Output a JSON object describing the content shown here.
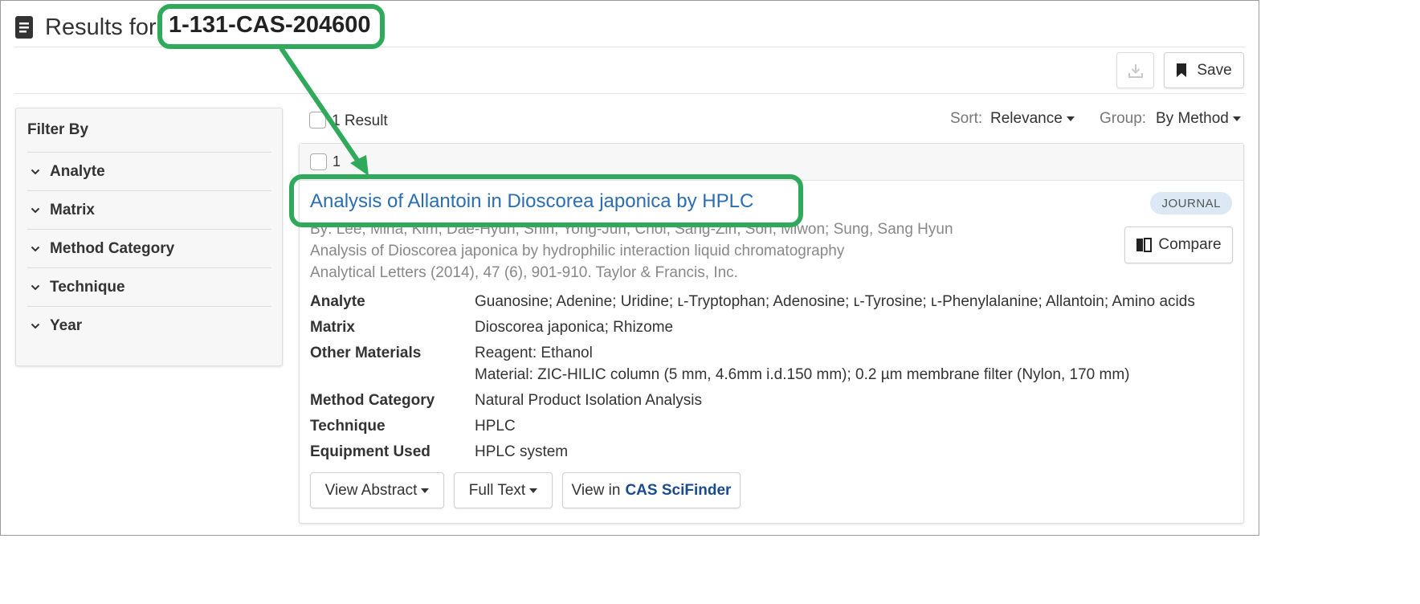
{
  "header": {
    "title_prefix": "Results for",
    "query": "1-131-CAS-204600"
  },
  "toolbar": {
    "download_icon": "download-icon",
    "save_label": "Save",
    "save_icon": "bookmark-icon"
  },
  "filter": {
    "title": "Filter By",
    "items": [
      {
        "label": "Analyte"
      },
      {
        "label": "Matrix"
      },
      {
        "label": "Method Category"
      },
      {
        "label": "Technique"
      },
      {
        "label": "Year"
      }
    ]
  },
  "results_bar": {
    "count": "1 Result",
    "sort_label": "Sort:",
    "sort_value": "Relevance",
    "group_label": "Group:",
    "group_value": "By Method"
  },
  "result": {
    "index": "1",
    "title": "Analysis of Allantoin in Dioscorea japonica by HPLC",
    "badge": "JOURNAL",
    "compare_label": "Compare",
    "authors": "By: Lee, Mina; Kim, Dae-Hyun; Shin, Yong-Jun; Choi, Sang-Zin; Son, Miwon; Sung, Sang Hyun",
    "subtitle": "Analysis of Dioscorea japonica by hydrophilic interaction liquid chromatography",
    "citation": "Analytical Letters (2014), 47 (6), 901-910. Taylor & Francis, Inc.",
    "fields": [
      {
        "label": "Analyte",
        "value": "Guanosine; Adenine; Uridine; ʟ-Tryptophan; Adenosine; ʟ-Tyrosine; ʟ-Phenylalanine; Allantoin; Amino acids"
      },
      {
        "label": "Matrix",
        "value": "Dioscorea japonica; Rhizome"
      },
      {
        "label": "Other Materials",
        "value": "Reagent: Ethanol",
        "value2": "Material: ZIC-HILIC column (5 mm, 4.6mm i.d.150 mm); 0.2 µm membrane filter (Nylon, 170 mm)"
      },
      {
        "label": "Method Category",
        "value": "Natural Product Isolation Analysis"
      },
      {
        "label": "Technique",
        "value": "HPLC"
      },
      {
        "label": "Equipment Used",
        "value": "HPLC system"
      }
    ],
    "buttons": {
      "view_abstract": "View Abstract",
      "full_text": "Full Text",
      "view_in": "View in",
      "scifinder": "CAS SciFinder"
    }
  },
  "colors": {
    "link": "#2a6db3",
    "callout": "#2faa5a",
    "badge_bg": "#dce8f3",
    "scifinder": "#1b4b8f"
  }
}
